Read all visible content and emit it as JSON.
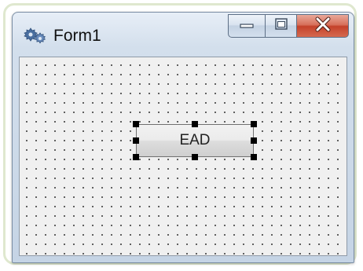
{
  "window": {
    "title": "Form1",
    "app_icon": "gear-icon"
  },
  "caption_buttons": {
    "minimize_icon": "minimize-icon",
    "maximize_icon": "maximize-icon",
    "close_icon": "close-icon"
  },
  "designer": {
    "button_label": "EAD",
    "grid": "dotted"
  },
  "colors": {
    "title_bar": "#d3dfec",
    "close_button": "#c4412a",
    "client_background": "#f0f0f0",
    "grid_dots": "#3c3c3c",
    "selection_handles": "#000000"
  }
}
